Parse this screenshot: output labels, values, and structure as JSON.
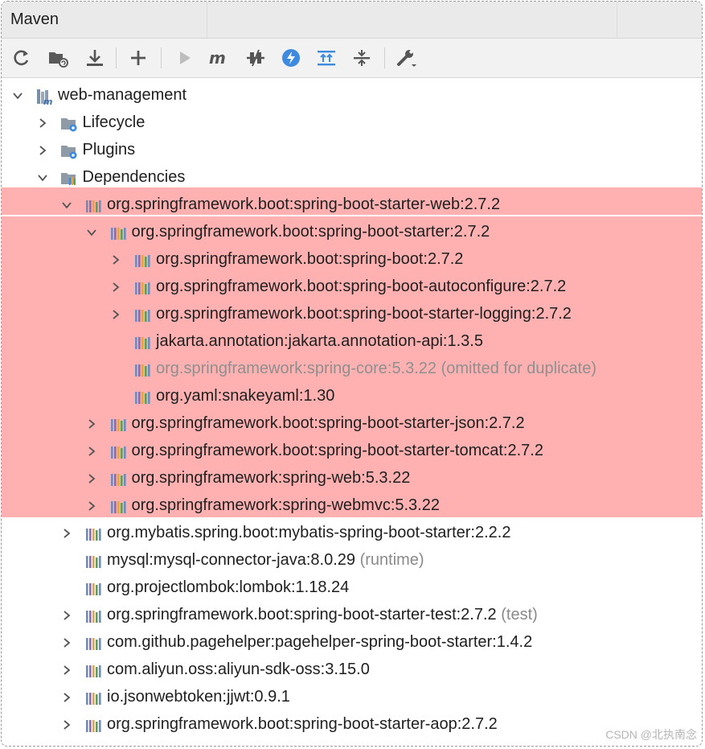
{
  "window": {
    "title": "Maven"
  },
  "toolbar": {
    "buttons": [
      {
        "name": "reload-icon"
      },
      {
        "name": "generate-sources-icon"
      },
      {
        "name": "download-icon"
      },
      {
        "name": "add-icon"
      },
      {
        "name": "run-icon"
      },
      {
        "name": "execute-goal-icon"
      },
      {
        "name": "toggle-offline-icon"
      },
      {
        "name": "skip-tests-icon"
      },
      {
        "name": "expand-all-icon"
      },
      {
        "name": "collapse-all-icon"
      },
      {
        "name": "settings-icon"
      }
    ]
  },
  "tree": {
    "nodes": [
      {
        "label": "web-management",
        "suffix": "",
        "icon": "maven-project-icon",
        "arrow": "down",
        "dim": false
      },
      {
        "label": "Lifecycle",
        "suffix": "",
        "icon": "folder-gear-icon",
        "arrow": "right",
        "dim": false
      },
      {
        "label": "Plugins",
        "suffix": "",
        "icon": "folder-gear-icon",
        "arrow": "right",
        "dim": false
      },
      {
        "label": "Dependencies",
        "suffix": "",
        "icon": "folder-library-icon",
        "arrow": "down",
        "dim": false
      },
      {
        "label": "org.springframework.boot:spring-boot-starter-web:2.7.2",
        "suffix": "",
        "icon": "library-icon",
        "arrow": "down",
        "dim": false
      },
      {
        "label": "org.springframework.boot:spring-boot-starter:2.7.2",
        "suffix": "",
        "icon": "library-icon",
        "arrow": "down",
        "dim": false
      },
      {
        "label": "org.springframework.boot:spring-boot:2.7.2",
        "suffix": "",
        "icon": "library-icon",
        "arrow": "right",
        "dim": false
      },
      {
        "label": "org.springframework.boot:spring-boot-autoconfigure:2.7.2",
        "suffix": "",
        "icon": "library-icon",
        "arrow": "right",
        "dim": false
      },
      {
        "label": "org.springframework.boot:spring-boot-starter-logging:2.7.2",
        "suffix": "",
        "icon": "library-icon",
        "arrow": "right",
        "dim": false
      },
      {
        "label": "jakarta.annotation:jakarta.annotation-api:1.3.5",
        "suffix": "",
        "icon": "library-icon",
        "arrow": "none",
        "dim": false
      },
      {
        "label": "org.springframework:spring-core:5.3.22 (omitted for duplicate)",
        "suffix": "",
        "icon": "library-icon",
        "arrow": "none",
        "dim": true
      },
      {
        "label": "org.yaml:snakeyaml:1.30",
        "suffix": "",
        "icon": "library-icon",
        "arrow": "none",
        "dim": false
      },
      {
        "label": "org.springframework.boot:spring-boot-starter-json:2.7.2",
        "suffix": "",
        "icon": "library-icon",
        "arrow": "right",
        "dim": false
      },
      {
        "label": "org.springframework.boot:spring-boot-starter-tomcat:2.7.2",
        "suffix": "",
        "icon": "library-icon",
        "arrow": "right",
        "dim": false
      },
      {
        "label": "org.springframework:spring-web:5.3.22",
        "suffix": "",
        "icon": "library-icon",
        "arrow": "right",
        "dim": false
      },
      {
        "label": "org.springframework:spring-webmvc:5.3.22",
        "suffix": "",
        "icon": "library-icon",
        "arrow": "right",
        "dim": false
      },
      {
        "label": "org.mybatis.spring.boot:mybatis-spring-boot-starter:2.2.2",
        "suffix": "",
        "icon": "library-icon",
        "arrow": "right",
        "dim": false
      },
      {
        "label": "mysql:mysql-connector-java:8.0.29",
        "suffix": "(runtime)",
        "icon": "library-icon",
        "arrow": "none",
        "dim": false
      },
      {
        "label": "org.projectlombok:lombok:1.18.24",
        "suffix": "",
        "icon": "library-icon",
        "arrow": "none",
        "dim": false
      },
      {
        "label": "org.springframework.boot:spring-boot-starter-test:2.7.2",
        "suffix": "(test)",
        "icon": "library-icon",
        "arrow": "right",
        "dim": false
      },
      {
        "label": "com.github.pagehelper:pagehelper-spring-boot-starter:1.4.2",
        "suffix": "",
        "icon": "library-icon",
        "arrow": "right",
        "dim": false
      },
      {
        "label": "com.aliyun.oss:aliyun-sdk-oss:3.15.0",
        "suffix": "",
        "icon": "library-icon",
        "arrow": "right",
        "dim": false
      },
      {
        "label": "io.jsonwebtoken:jjwt:0.9.1",
        "suffix": "",
        "icon": "library-icon",
        "arrow": "right",
        "dim": false
      },
      {
        "label": "org.springframework.boot:spring-boot-starter-aop:2.7.2",
        "suffix": "",
        "icon": "library-icon",
        "arrow": "right",
        "dim": false
      }
    ]
  },
  "colors": {
    "highlight": "#ffb1b1",
    "accent_blue": "#3d8ae0",
    "library_bars": [
      "#6c8ebf",
      "#8c6bb1",
      "#e8a33d",
      "#5aa05a"
    ]
  },
  "watermark": {
    "text": "CSDN @北执南念"
  }
}
